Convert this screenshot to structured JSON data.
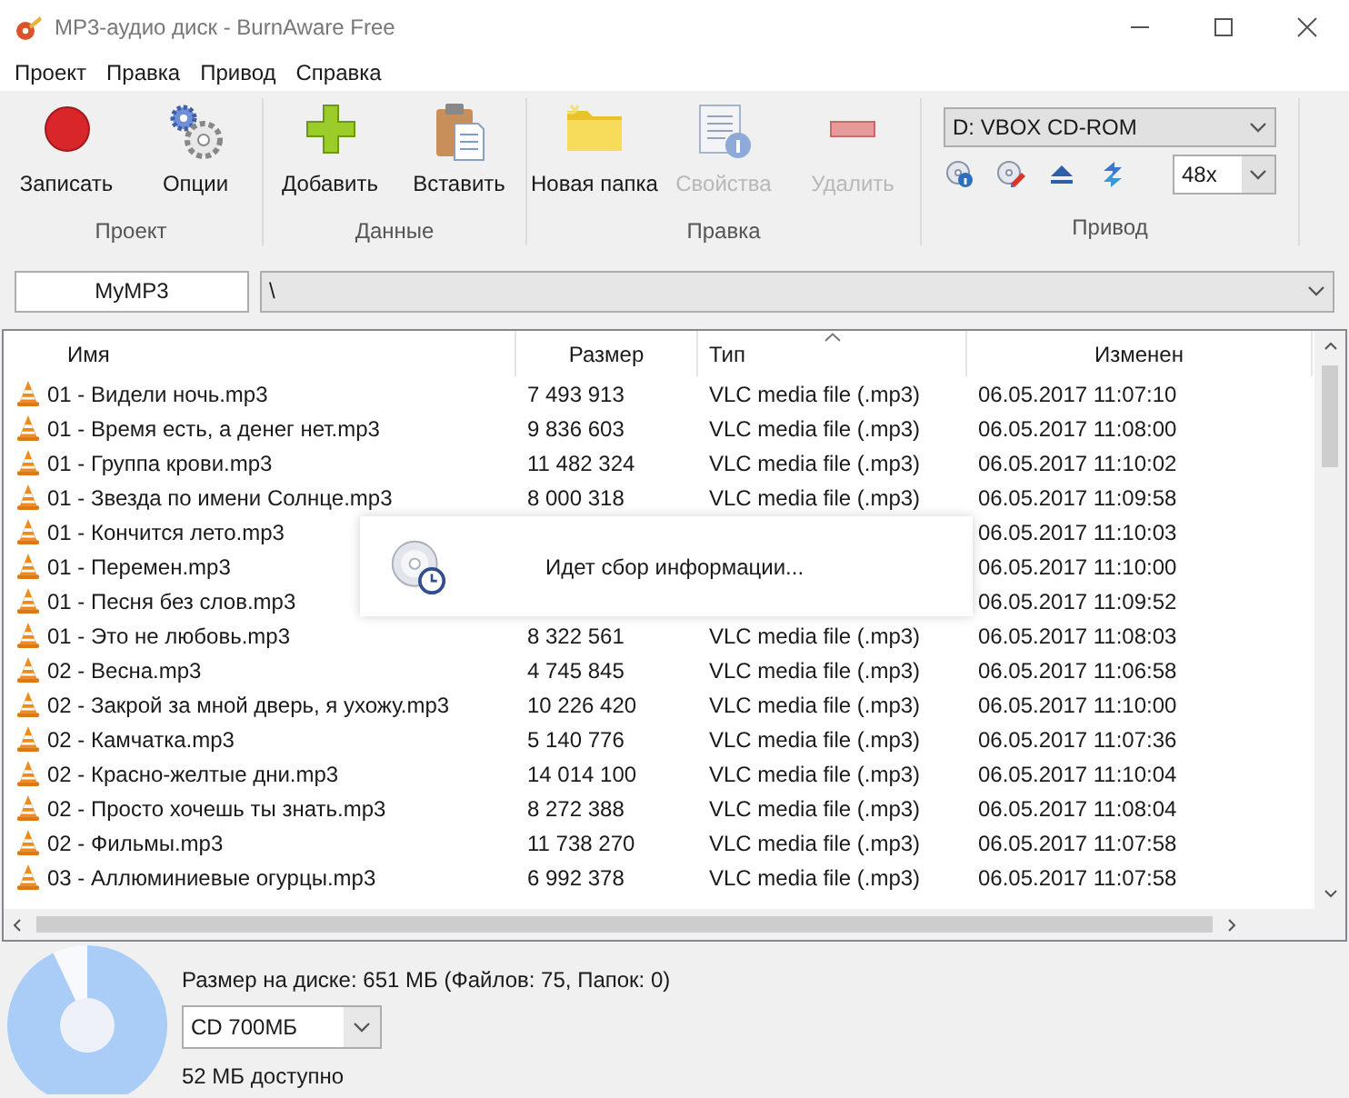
{
  "window": {
    "title": "MP3-аудио диск - BurnAware Free"
  },
  "menu": [
    "Проект",
    "Правка",
    "Привод",
    "Справка"
  ],
  "toolbar": {
    "groups": [
      {
        "label": "Проект",
        "buttons": [
          {
            "label": "Записать",
            "disabled": false
          },
          {
            "label": "Опции",
            "disabled": false
          }
        ]
      },
      {
        "label": "Данные",
        "buttons": [
          {
            "label": "Добавить",
            "disabled": false
          },
          {
            "label": "Вставить",
            "disabled": false
          }
        ]
      },
      {
        "label": "Правка",
        "buttons": [
          {
            "label": "Новая папка",
            "disabled": false
          },
          {
            "label": "Свойства",
            "disabled": true
          },
          {
            "label": "Удалить",
            "disabled": true
          }
        ]
      }
    ],
    "drive": {
      "label": "Привод",
      "device": "D: VBOX CD-ROM",
      "speed": "48x"
    }
  },
  "path_bar": {
    "project": "MyMP3",
    "path": "\\"
  },
  "table": {
    "columns": [
      {
        "label": "Имя",
        "sorted": false
      },
      {
        "label": "Размер",
        "sorted": false
      },
      {
        "label": "Тип",
        "sorted": true
      },
      {
        "label": "Изменен",
        "sorted": false
      }
    ],
    "rows": [
      {
        "name": "01 - Видели ночь.mp3",
        "size": "7 493 913",
        "type": "VLC media file (.mp3)",
        "modified": "06.05.2017 11:07:10"
      },
      {
        "name": "01 - Время есть, а денег нет.mp3",
        "size": "9 836 603",
        "type": "VLC media file (.mp3)",
        "modified": "06.05.2017 11:08:00"
      },
      {
        "name": "01 - Группа крови.mp3",
        "size": "11 482 324",
        "type": "VLC media file (.mp3)",
        "modified": "06.05.2017 11:10:02"
      },
      {
        "name": "01 - Звезда по имени Солнце.mp3",
        "size": "8 000 318",
        "type": "VLC media file (.mp3)",
        "modified": "06.05.2017 11:09:58"
      },
      {
        "name": "01 - Кончится лето.mp3",
        "modified": "06.05.2017 11:10:03"
      },
      {
        "name": "01 - Перемен.mp3",
        "modified": "06.05.2017 11:10:00"
      },
      {
        "name": "01 - Песня без слов.mp3",
        "modified": "06.05.2017 11:09:52"
      },
      {
        "name": "01 - Это не любовь.mp3",
        "size": "8 322 561",
        "type": "VLC media file (.mp3)",
        "modified": "06.05.2017 11:08:03"
      },
      {
        "name": "02 - Весна.mp3",
        "size": "4 745 845",
        "type": "VLC media file (.mp3)",
        "modified": "06.05.2017 11:06:58"
      },
      {
        "name": "02 - Закрой за мной дверь, я ухожу.mp3",
        "size": "10 226 420",
        "type": "VLC media file (.mp3)",
        "modified": "06.05.2017 11:10:00"
      },
      {
        "name": "02 - Камчатка.mp3",
        "size": "5 140 776",
        "type": "VLC media file (.mp3)",
        "modified": "06.05.2017 11:07:36"
      },
      {
        "name": "02 - Красно-желтые дни.mp3",
        "size": "14 014 100",
        "type": "VLC media file (.mp3)",
        "modified": "06.05.2017 11:10:04"
      },
      {
        "name": "02 - Просто хочешь ты знать.mp3",
        "size": "8 272 388",
        "type": "VLC media file (.mp3)",
        "modified": "06.05.2017 11:08:04"
      },
      {
        "name": "02 - Фильмы.mp3",
        "size": "11 738 270",
        "type": "VLC media file (.mp3)",
        "modified": "06.05.2017 11:07:58"
      },
      {
        "name": "03 - Аллюминиевые огурцы.mp3",
        "size": "6 992 378",
        "type": "VLC media file (.mp3)",
        "modified": "06.05.2017 11:07:58"
      }
    ]
  },
  "progress_popup": {
    "message": "Идет сбор информации..."
  },
  "status": {
    "disc_usage": {
      "level": 0.93
    },
    "size_text": "Размер на диске: 651 МБ (Файлов: 75, Папок: 0)",
    "disc_type": "CD 700МБ",
    "free_text": "52 МБ доступно"
  }
}
